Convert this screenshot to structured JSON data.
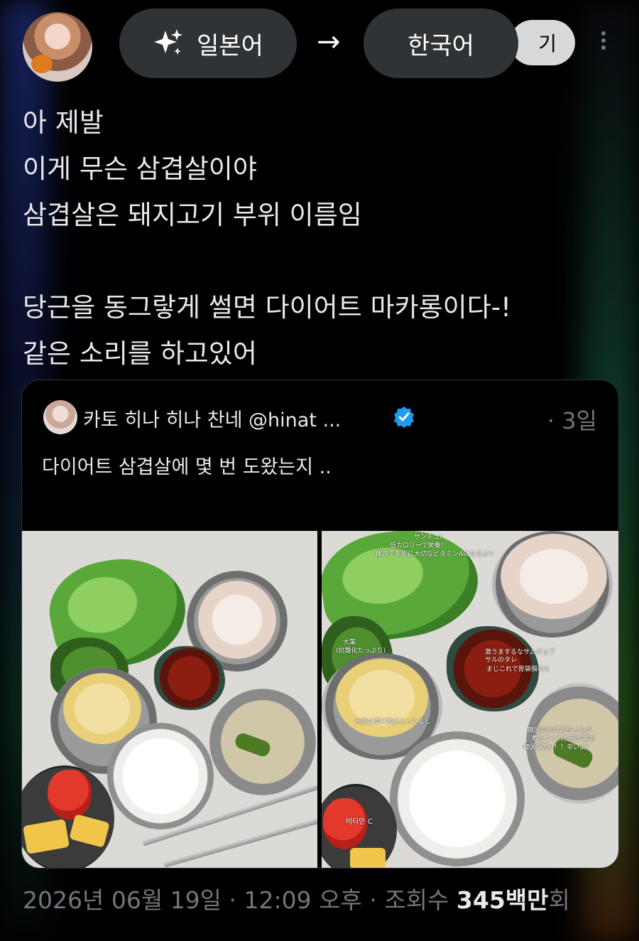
{
  "header": {
    "source_language": "일본어",
    "target_language": "한국어",
    "partial_button_label": "기",
    "arrow_glyph": "→"
  },
  "tweet": {
    "lines": [
      "아 제발",
      "이게 무슨 삼겹살이야",
      "삼겹살은 돼지고기 부위 이름임",
      "",
      "당근을 동그랗게 썰면 다이어트 마카롱이다-!",
      "같은 소리를 하고있어"
    ]
  },
  "quote": {
    "author": "카토 히나 히나 찬네 @hinat ...",
    "time": "· 3일",
    "text": "다이어트 삼겹살에 몇 번 도왔는지 ..",
    "photo2_annotations": {
      "lettuce": "サンチュ!",
      "lettuce_note": "低カロリーで栄養!",
      "lettuce_note2": "体内でお肌に大切なビタミンAになるよ!!",
      "perilla": "大葉",
      "perilla_note": "(抗酸化たっぷり)",
      "sauce": "激うまするなサムギョプサルのタレ",
      "sauce_note": "まじこれで胃袋掴めた",
      "radish_note": "大根の漬け物が入ってるし",
      "soup": "韓国のおばあちゃんが",
      "soup_note": "教えてくれた我が家の",
      "soup_note2": "韓国味噌!!！！辛いよ!",
      "fruit": "비타민 C"
    }
  },
  "footer": {
    "date": "2026년 06월 19일",
    "sep1": " · ",
    "time": "12:09 오후",
    "sep2": " · ",
    "views_label": "조회수 ",
    "views_count": "345백만",
    "views_suffix": "회"
  },
  "colors": {
    "background": "#000000",
    "pill": "#2f3336",
    "text": "#e7e9ea",
    "muted": "#71767b",
    "verified": "#1d9bf0"
  }
}
